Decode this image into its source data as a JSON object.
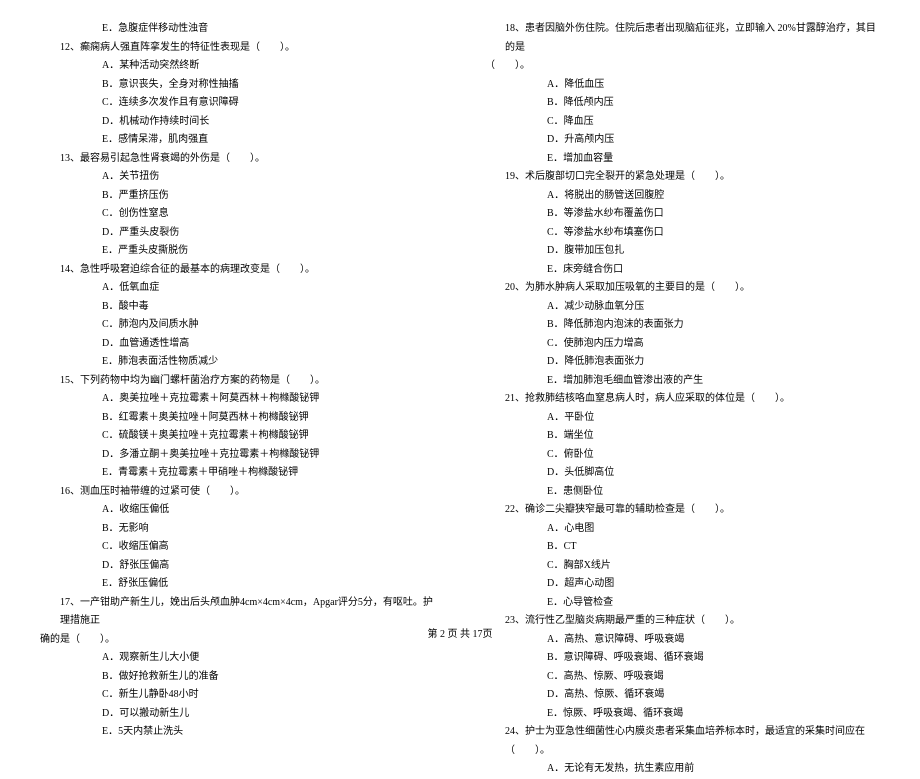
{
  "leftCol": {
    "continuedOption": "E．急腹症伴移动性浊音",
    "questions": [
      {
        "num": "12",
        "stem": "、癫痫病人强直阵挛发生的特征性表现是（　　）。",
        "options": [
          "A．某种活动突然终断",
          "B．意识丧失，全身对称性抽搐",
          "C．连续多次发作且有意识障碍",
          "D．机械动作持续时间长",
          "E．感情呆滞，肌肉强直"
        ]
      },
      {
        "num": "13",
        "stem": "、最容易引起急性肾衰竭的外伤是（　　）。",
        "options": [
          "A．关节扭伤",
          "B．严重挤压伤",
          "C．创伤性窒息",
          "D．严重头皮裂伤",
          "E．严重头皮撕脱伤"
        ]
      },
      {
        "num": "14",
        "stem": "、急性呼吸窘迫综合征的最基本的病理改变是（　　）。",
        "options": [
          "A．低氧血症",
          "B．酸中毒",
          "C．肺泡内及间质水肿",
          "D．血管通透性增高",
          "E．肺泡表面活性物质减少"
        ]
      },
      {
        "num": "15",
        "stem": "、下列药物中均为幽门螺杆菌治疗方案的药物是（　　）。",
        "options": [
          "A．奥美拉唑＋克拉霉素＋阿莫西林＋枸橼酸铋钾",
          "B．红霉素＋奥美拉唑＋阿莫西林＋枸橼酸铋钾",
          "C．硫酸镁＋奥美拉唑＋克拉霉素＋枸橼酸铋钾",
          "D．多潘立酮＋奥美拉唑＋克拉霉素＋枸橼酸铋钾",
          "E．青霉素＋克拉霉素＋甲硝唑＋枸橼酸铋钾"
        ]
      },
      {
        "num": "16",
        "stem": "、测血压时袖带缠的过紧可使（　　）。",
        "options": [
          "A．收缩压偏低",
          "B．无影响",
          "C．收缩压偏高",
          "D．舒张压偏高",
          "E．舒张压偏低"
        ]
      },
      {
        "num": "17",
        "stem": "、一产钳助产新生儿，娩出后头颅血肿4cm×4cm×4cm，Apgar评分5分，有呕吐。护理措施正",
        "wrapLine": "确的是（　　）。",
        "options": [
          "A．观察新生儿大小便",
          "B．做好抢救新生儿的准备",
          "C．新生儿静卧48小时",
          "D．可以搬动新生儿",
          "E．5天内禁止洗头"
        ]
      }
    ]
  },
  "rightCol": {
    "questions": [
      {
        "num": "18",
        "stem": "、患者因脑外伤住院。住院后患者出现脑疝征兆，立即输入 20%甘露醇治疗，其目的是",
        "wrapLine": "（　　）。",
        "options": [
          "A．降低血压",
          "B．降低颅内压",
          "C．降血压",
          "D．升高颅内压",
          "E．增加血容量"
        ]
      },
      {
        "num": "19",
        "stem": "、术后腹部切口完全裂开的紧急处理是（　　）。",
        "options": [
          "A．将脱出的肠管送回腹腔",
          "B．等渗盐水纱布覆盖伤口",
          "C．等渗盐水纱布填塞伤口",
          "D．腹带加压包扎",
          "E．床旁缝合伤口"
        ]
      },
      {
        "num": "20",
        "stem": "、为肺水肿病人采取加压吸氧的主要目的是（　　）。",
        "options": [
          "A．减少动脉血氧分压",
          "B．降低肺泡内泡沫的表面张力",
          "C．使肺泡内压力增高",
          "D．降低肺泡表面张力",
          "E．增加肺泡毛细血管渗出液的产生"
        ]
      },
      {
        "num": "21",
        "stem": "、抢救肺结核咯血窒息病人时，病人应采取的体位是（　　）。",
        "options": [
          "A．平卧位",
          "B．端坐位",
          "C．俯卧位",
          "D．头低脚高位",
          "E．患侧卧位"
        ]
      },
      {
        "num": "22",
        "stem": "、确诊二尖瓣狭窄最可靠的辅助检查是（　　）。",
        "options": [
          "A．心电图",
          "B．CT",
          "C．胸部X线片",
          "D．超声心动图",
          "E．心导管检查"
        ]
      },
      {
        "num": "23",
        "stem": "、流行性乙型脑炎病期最严重的三种症状（　　）。",
        "options": [
          "A．高热、意识障碍、呼吸衰竭",
          "B．意识障碍、呼吸衰竭、循环衰竭",
          "C．高热、惊厥、呼吸衰竭",
          "D．高热、惊厥、循环衰竭",
          "E．惊厥、呼吸衰竭、循环衰竭"
        ]
      },
      {
        "num": "24",
        "stem": "、护士为亚急性细菌性心内膜炎患者采集血培养标本时，最适宜的采集时间应在（　　）。",
        "options": [
          "A．无论有无发热，抗生素应用前"
        ]
      }
    ]
  },
  "footer": "第 2 页 共 17页"
}
